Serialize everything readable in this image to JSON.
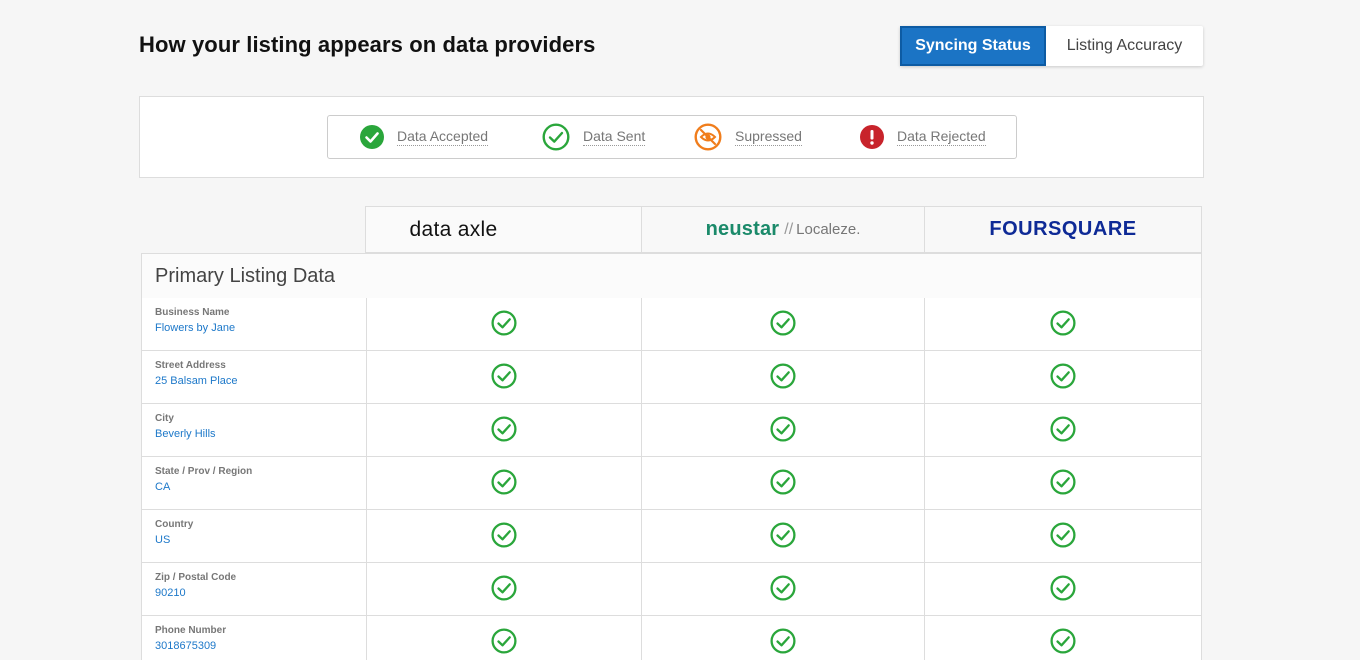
{
  "header": {
    "title": "How your listing appears on data providers"
  },
  "view_toggle": {
    "active": "Syncing Status",
    "inactive": "Listing Accuracy"
  },
  "legend": [
    {
      "label": "Data Accepted",
      "icon": "check-filled-icon",
      "color": "#2aa63b"
    },
    {
      "label": "Data Sent",
      "icon": "check-outline-icon",
      "color": "#2aa63b"
    },
    {
      "label": "Supressed",
      "icon": "eye-slash-icon",
      "color": "#f07d1c"
    },
    {
      "label": "Data Rejected",
      "icon": "exclamation-icon",
      "color": "#c8232b"
    }
  ],
  "providers": {
    "data_axle": "data axle",
    "neustar": "neustar",
    "neustar_separator": "//",
    "localeze": "Localeze.",
    "foursquare": "FOURSQUARE"
  },
  "section": {
    "title": "Primary Listing Data"
  },
  "rows": [
    {
      "label": "Business Name",
      "value": "Flowers by Jane",
      "status": [
        "Data Sent",
        "Data Sent",
        "Data Sent"
      ]
    },
    {
      "label": "Street Address",
      "value": "25 Balsam Place",
      "status": [
        "Data Sent",
        "Data Sent",
        "Data Sent"
      ]
    },
    {
      "label": "City",
      "value": "Beverly Hills",
      "status": [
        "Data Sent",
        "Data Sent",
        "Data Sent"
      ]
    },
    {
      "label": "State / Prov / Region",
      "value": "CA",
      "status": [
        "Data Sent",
        "Data Sent",
        "Data Sent"
      ]
    },
    {
      "label": "Country",
      "value": "US",
      "status": [
        "Data Sent",
        "Data Sent",
        "Data Sent"
      ]
    },
    {
      "label": "Zip / Postal Code",
      "value": "90210",
      "status": [
        "Data Sent",
        "Data Sent",
        "Data Sent"
      ]
    },
    {
      "label": "Phone Number",
      "value": "3018675309",
      "status": [
        "Data Sent",
        "Data Sent",
        "Data Sent"
      ]
    }
  ],
  "colors": {
    "accent": "#1b74c5",
    "status_ok": "#2aa63b",
    "link": "#1d78c9"
  }
}
